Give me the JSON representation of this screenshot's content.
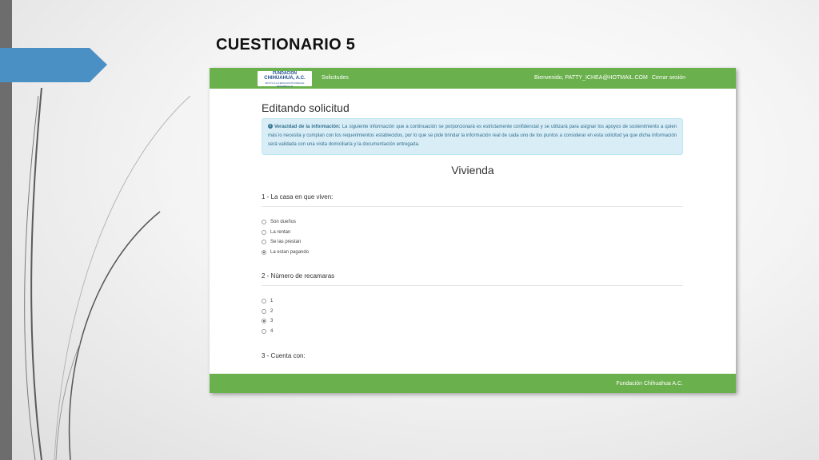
{
  "slide": {
    "title": "CUESTIONARIO 5"
  },
  "nav": {
    "logo": {
      "line1": "FUNDACION",
      "line2": "CHIHUAHUA, A.C.",
      "line3": "APOYO A LA EDUCACION PARA EL DESARROLLO"
    },
    "solicitudes": "Solicitudes",
    "welcome": "Bienvenido, PATTY_ICHEA@HOTMAIL.COM",
    "logout": "Cerrar sesión"
  },
  "page": {
    "heading": "Editando solicitud",
    "alert": {
      "icon": "info-icon",
      "title": "Veracidad de la información:",
      "body": "La siguiente información que a continuación se porporcionará es estrictamente confidencial y se utilizará para asignar los apoyos de sostenimiento a quien más lo necesita y cumplan con los requerimientos establecidos, por lo que se pide brindar la información real de cada uno de los puntos a considerar en esta solicitud ya que dicha información será validada con una visita domiciliaria y la documentación entregada."
    },
    "section": "Vivienda"
  },
  "questions": [
    {
      "label": "1 - La casa en que viven:",
      "options": [
        "Son dueños",
        "La rentan",
        "Se las prestan",
        "La estan pagando"
      ],
      "selected": 3
    },
    {
      "label": "2 - Número de recamaras",
      "options": [
        "1",
        "2",
        "3",
        "4"
      ],
      "selected": 2
    },
    {
      "label": "3 - Cuenta con:"
    }
  ],
  "footer": {
    "text": "Fundación Chihuahua A.C."
  },
  "colors": {
    "nav_green": "#6ab04c",
    "accent_blue": "#4a90c4",
    "alert_bg": "#d9edf7"
  }
}
